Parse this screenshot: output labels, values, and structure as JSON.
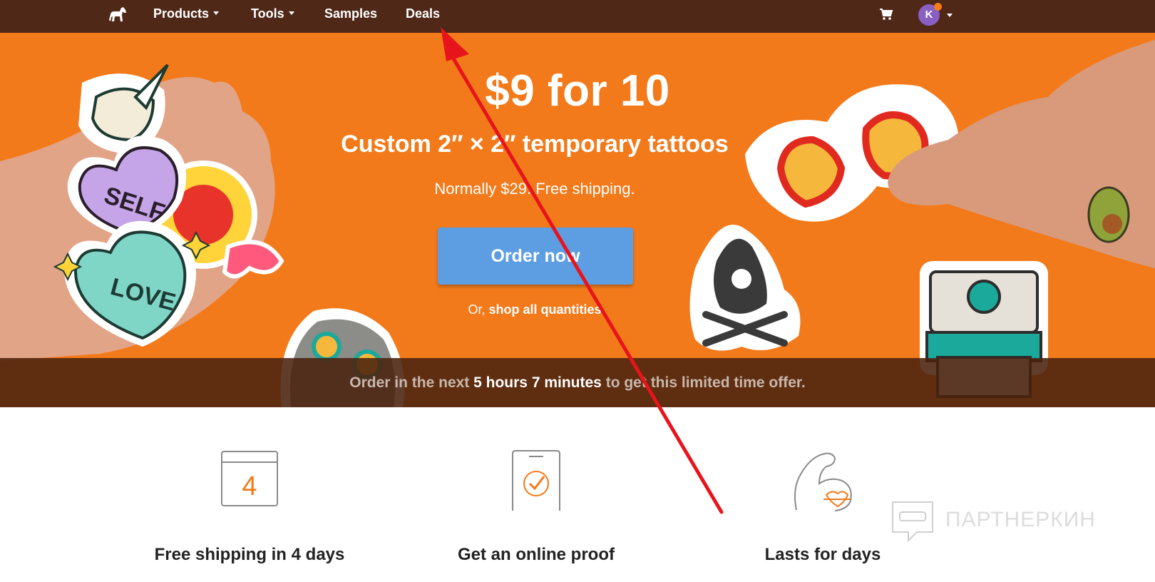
{
  "nav": {
    "logo_icon": "horse-logo-icon",
    "items": [
      {
        "label": "Products",
        "has_dropdown": true
      },
      {
        "label": "Tools",
        "has_dropdown": true
      },
      {
        "label": "Samples",
        "has_dropdown": false
      },
      {
        "label": "Deals",
        "has_dropdown": false
      }
    ],
    "cart_icon": "cart-icon",
    "avatar_initial": "K",
    "avatar_color": "#8a5fc4",
    "notification_dot_color": "#f77b1a",
    "background_color": "#4f2818"
  },
  "hero": {
    "background_color": "#f27a1b",
    "headline": "$9 for 10",
    "subheadline": "Custom 2″ × 2″ temporary tattoos",
    "note": "Normally $29. Free shipping.",
    "cta_label": "Order now",
    "cta_color": "#5d9ee2",
    "or_prefix": "Or,",
    "or_link": "shop all quantities",
    "timer_prefix": "Order in the next",
    "timer_value": "5 hours 7 minutes",
    "timer_suffix": "to get this limited time offer.",
    "sticker_labels": {
      "heart_top": "SELF",
      "heart_bottom": "LOVE"
    }
  },
  "features": [
    {
      "icon": "calendar-icon",
      "icon_number": "4",
      "title": "Free shipping in 4 days"
    },
    {
      "icon": "phone-check-icon",
      "title": "Get an online proof"
    },
    {
      "icon": "flexed-arm-icon",
      "title": "Lasts for days"
    }
  ],
  "watermark": {
    "text": "ПАРТНЕРКИН"
  },
  "annotation": {
    "color": "#e8141c"
  }
}
